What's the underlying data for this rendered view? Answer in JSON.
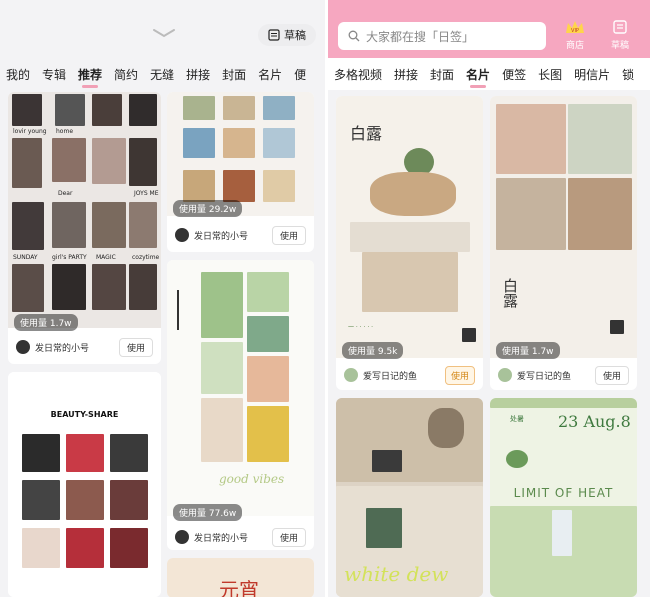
{
  "left": {
    "draft_label": "草稿",
    "tabs": [
      {
        "label": "我的"
      },
      {
        "label": "专辑"
      },
      {
        "label": "推荐",
        "active": true
      },
      {
        "label": "简约"
      },
      {
        "label": "无缝"
      },
      {
        "label": "拼接"
      },
      {
        "label": "封面"
      },
      {
        "label": "名片"
      },
      {
        "label": "便"
      }
    ],
    "cards": [
      {
        "usage": "使用量 1.7w",
        "author": "发日常的小号",
        "use_label": "使用"
      },
      {
        "usage": "使用量 29.2w",
        "author": "发日常的小号",
        "use_label": "使用"
      },
      {
        "usage": "使用量 77.6w",
        "author": "发日常的小号",
        "use_label": "使用"
      },
      {
        "title": "BEAUTY-SHARE"
      },
      {
        "title": "元宵"
      }
    ],
    "film_texts": [
      "lovir young",
      "home",
      "Dear",
      "SUNDAY",
      "girl's PARTY",
      "MAGIC",
      "cozytime",
      "JOYS ME"
    ],
    "green_card_text": "good vibes"
  },
  "right": {
    "search_placeholder": "大家都在搜「日签」",
    "vip_label": "商店",
    "draft_label": "草稿",
    "tabs": [
      {
        "label": "多格视频"
      },
      {
        "label": "拼接"
      },
      {
        "label": "封面"
      },
      {
        "label": "名片",
        "active": true
      },
      {
        "label": "便签"
      },
      {
        "label": "长图"
      },
      {
        "label": "明信片"
      },
      {
        "label": "锁"
      }
    ],
    "cards": [
      {
        "title": "白露",
        "usage": "使用量 9.5k",
        "author": "爱写日记的鱼",
        "use_label": "使用"
      },
      {
        "title": "白露",
        "usage": "使用量 1.7w",
        "author": "爱写日记的鱼",
        "use_label": "使用"
      },
      {
        "title": "white dew"
      },
      {
        "title": "23 Aug.8",
        "subtitle": "处暑",
        "caption": "LIMIT OF HEAT"
      }
    ]
  }
}
